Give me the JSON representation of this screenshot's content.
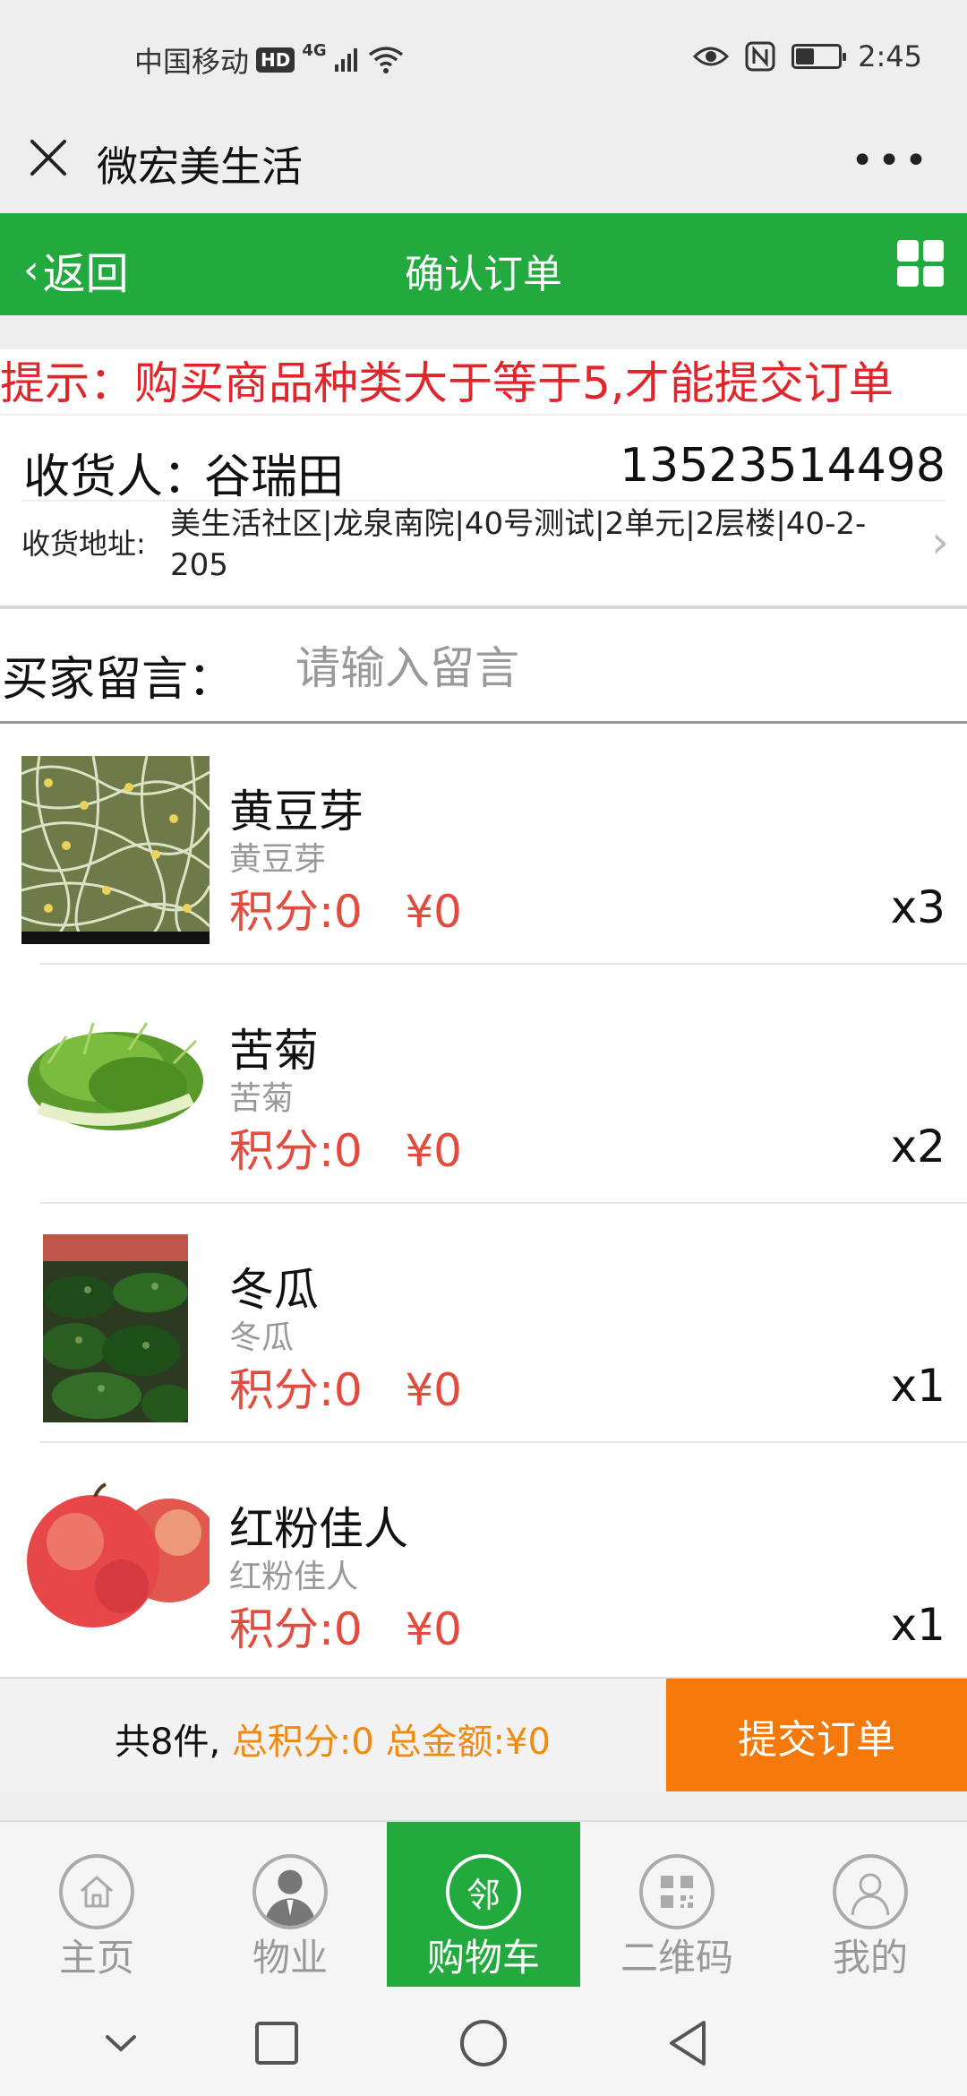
{
  "status_bar": {
    "carrier": "中国移动",
    "hd": "HD",
    "network": "4G",
    "time": "2:45"
  },
  "wechat_bar": {
    "title": "微宏美生活"
  },
  "header": {
    "back_label": "返回",
    "title": "确认订单"
  },
  "notice": "提示：购买商品种类大于等于5,才能提交订单",
  "address": {
    "recipient_label": "收货人：",
    "recipient_name": "谷瑞田",
    "phone": "13523514498",
    "address_label": "收货地址:",
    "address": "美生活社区|龙泉南院|40号测试|2单元|2层楼|40-2-205"
  },
  "message": {
    "label": "买家留言：",
    "placeholder": "请输入留言",
    "value": ""
  },
  "products": [
    {
      "name": "黄豆芽",
      "subtitle": "黄豆芽",
      "price": "积分:0   ¥0",
      "qty": "x3"
    },
    {
      "name": "苦菊",
      "subtitle": "苦菊",
      "price": "积分:0   ¥0",
      "qty": "x2"
    },
    {
      "name": "冬瓜",
      "subtitle": "冬瓜",
      "price": "积分:0   ¥0",
      "qty": "x1"
    },
    {
      "name": "红粉佳人",
      "subtitle": "红粉佳人",
      "price": "积分:0   ¥0",
      "qty": "x1"
    }
  ],
  "order_bar": {
    "count_text": "共8件, ",
    "totals_text": "总积分:0 总金额:¥0",
    "submit_label": "提交订单"
  },
  "tabs": [
    {
      "label": "主页",
      "icon": "home-icon",
      "active": false
    },
    {
      "label": "物业",
      "icon": "property-person-icon",
      "active": false
    },
    {
      "label": "购物车",
      "icon": "neighbor-cart-icon",
      "glyph": "邻",
      "active": true
    },
    {
      "label": "二维码",
      "icon": "qr-code-icon",
      "active": false
    },
    {
      "label": "我的",
      "icon": "profile-icon",
      "active": false
    }
  ],
  "colors": {
    "brand_green": "#22aa3e",
    "submit_orange": "#f5780b",
    "notice_red": "#e3242b",
    "price_red": "#e34b3f",
    "totals_orange": "#f08a10"
  }
}
